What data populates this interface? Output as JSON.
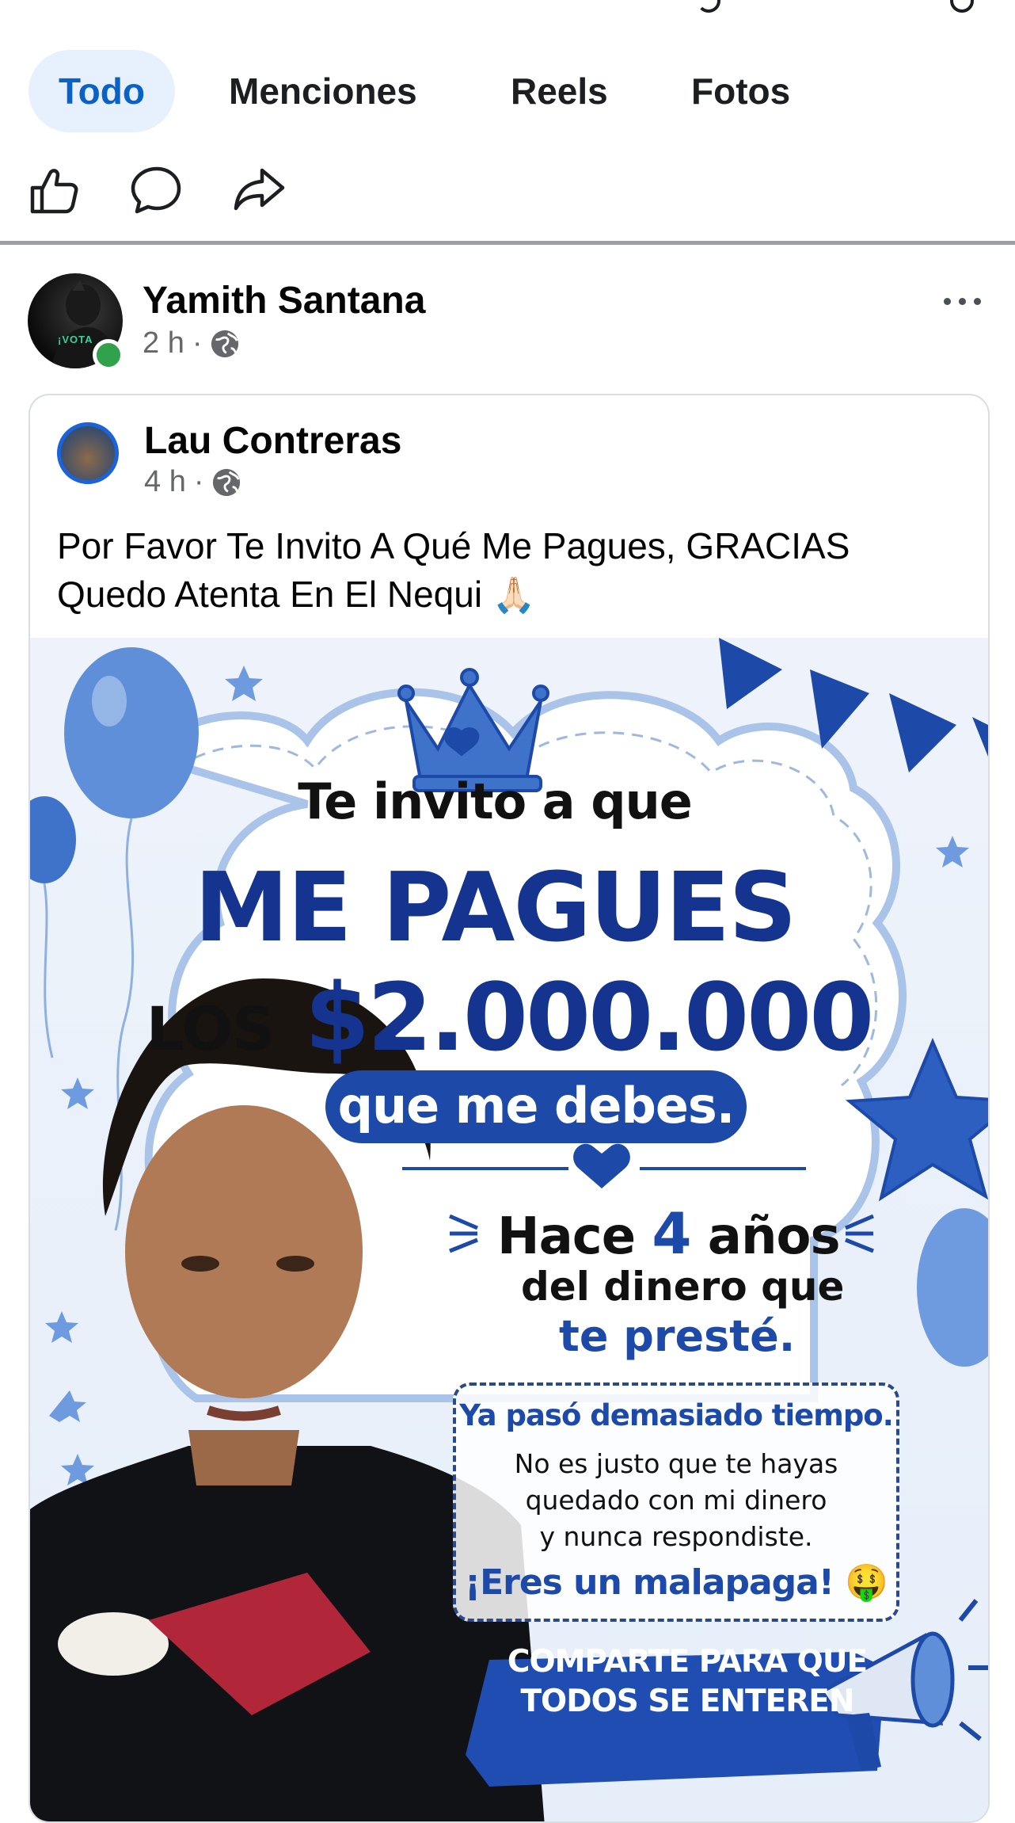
{
  "tabs": [
    {
      "label": "Todo",
      "active": true
    },
    {
      "label": "Menciones",
      "active": false
    },
    {
      "label": "Reels",
      "active": false
    },
    {
      "label": "Fotos",
      "active": false
    }
  ],
  "post": {
    "author": "Yamith Santana",
    "time": "2 h",
    "avatar_text": "¡VOTA",
    "shared": {
      "author": "Lau Contreras",
      "time": "4 h",
      "caption": "Por Favor Te Invito A Qué Me Pagues, GRACIAS Quedo Atenta En El Nequi",
      "caption_emoji": "🙏🏻",
      "flyer": {
        "line1": "Te invito a que",
        "line2": "ME PAGUES",
        "line3_prefix": "LOS",
        "line3_amount": "$2.000.000",
        "pill": "que me debes.",
        "hace_prefix": "Hace",
        "hace_number": "4",
        "hace_suffix": "años",
        "del": "del dinero que",
        "preste": "te presté.",
        "box_title": "Ya pasó demasiado tiempo.",
        "box_body_1": "No es justo que te hayas",
        "box_body_2": "quedado con mi dinero",
        "box_body_3": "y nunca respondiste.",
        "box_footer": "¡Eres un malapaga! 🤑",
        "banner_1": "COMPARTE PARA QUE",
        "banner_2": "TODOS SE ENTEREN"
      }
    }
  },
  "colors": {
    "accent": "#0a62c9",
    "tab_active_bg": "#e7f0fd",
    "online": "#31a24c",
    "flyer_blue": "#1d4aa8",
    "flyer_dark_blue": "#14348f"
  }
}
